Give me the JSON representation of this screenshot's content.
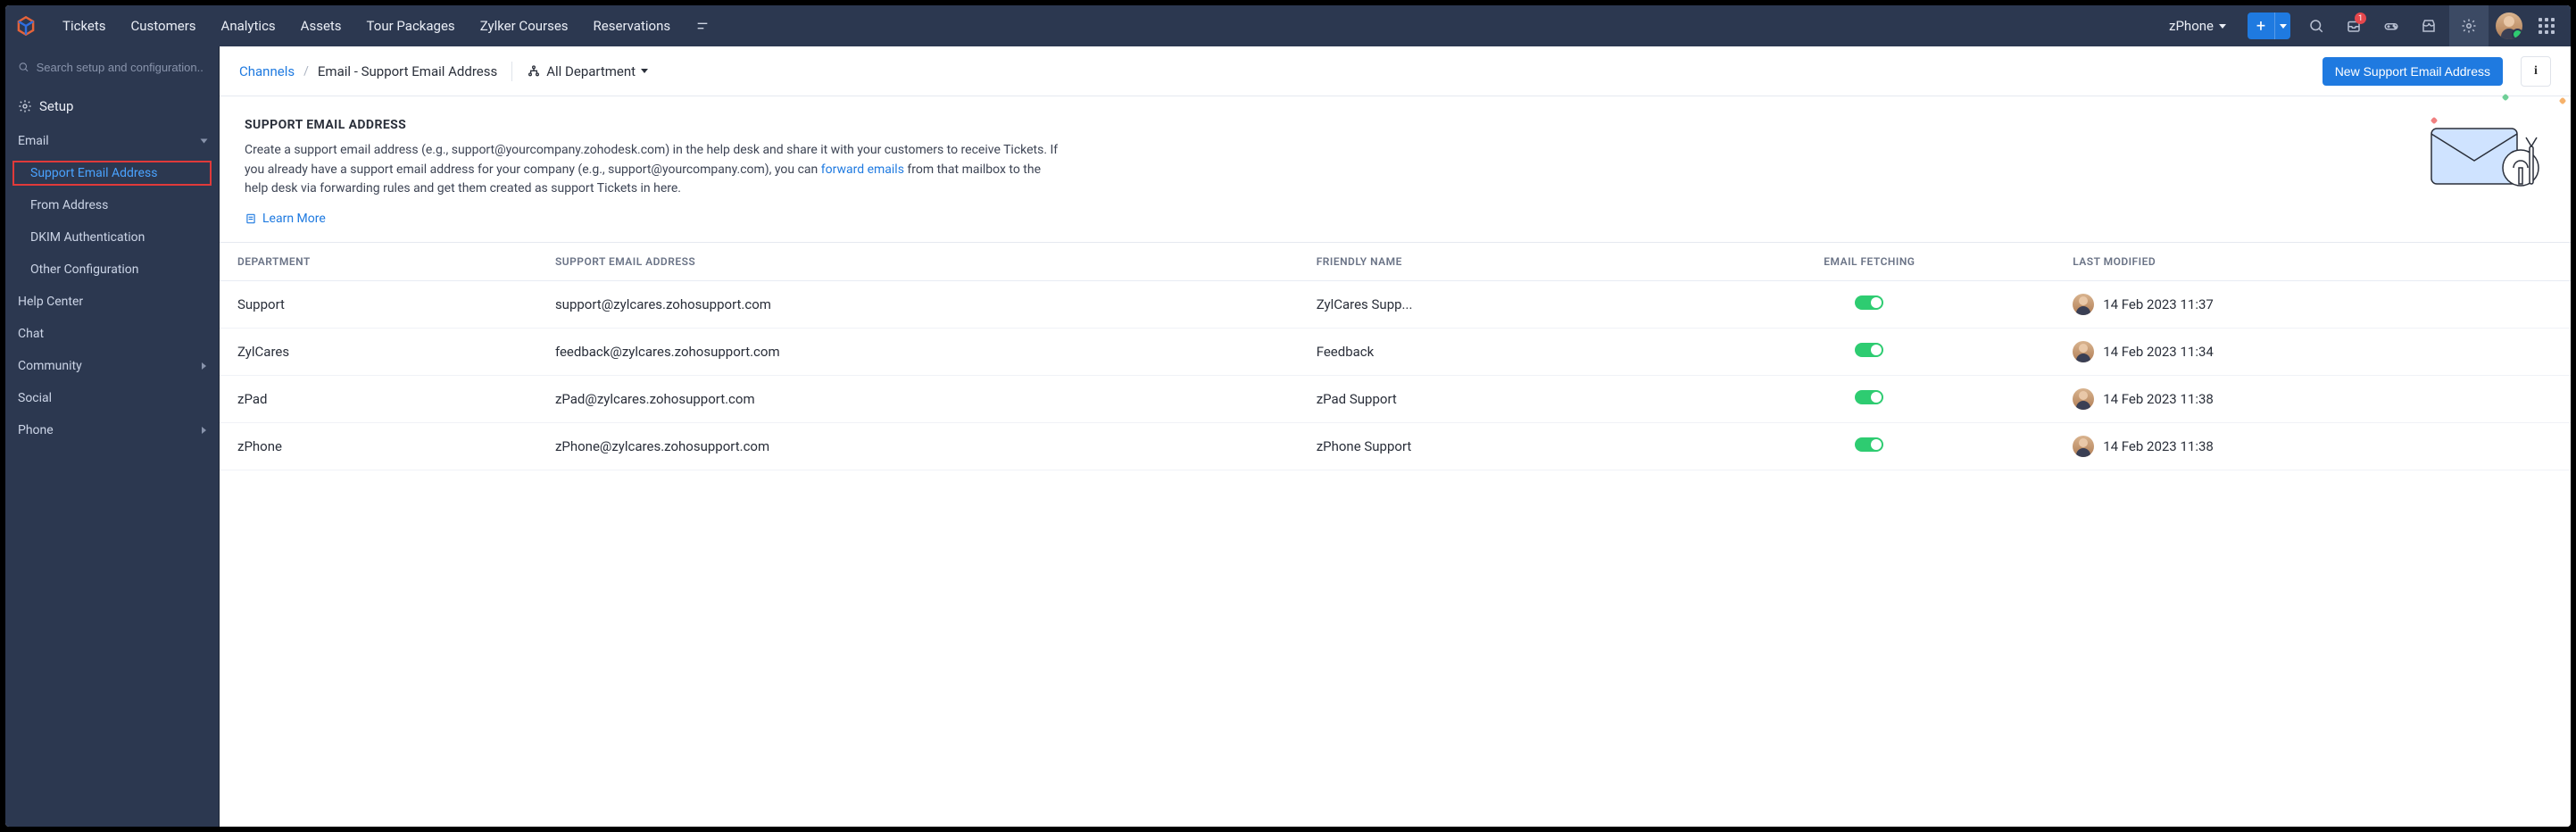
{
  "nav": {
    "items": [
      "Tickets",
      "Customers",
      "Analytics",
      "Assets",
      "Tour Packages",
      "Zylker Courses",
      "Reservations"
    ],
    "dept": "zPhone",
    "notif_badge": "1"
  },
  "sidebar": {
    "search_placeholder": "Search setup and configuration..",
    "section": "Setup",
    "items": [
      {
        "label": "Email",
        "expandable": true,
        "expanded": true
      },
      {
        "label": "Support Email Address",
        "sub": true,
        "active": true,
        "highlight": true
      },
      {
        "label": "From Address",
        "sub": true
      },
      {
        "label": "DKIM Authentication",
        "sub": true
      },
      {
        "label": "Other Configuration",
        "sub": true
      },
      {
        "label": "Help Center"
      },
      {
        "label": "Chat"
      },
      {
        "label": "Community",
        "expandable": true
      },
      {
        "label": "Social"
      },
      {
        "label": "Phone",
        "expandable": true
      }
    ]
  },
  "breadcrumb": {
    "root": "Channels",
    "current": "Email - Support Email Address",
    "filter": "All Department"
  },
  "actions": {
    "new_btn": "New Support Email Address",
    "info_btn": "i"
  },
  "intro": {
    "heading": "SUPPORT EMAIL ADDRESS",
    "text_a": "Create a support email address (e.g., support@yourcompany.zohodesk.com) in the help desk and share it with your customers to receive Tickets. If you already have a support email address for your company (e.g., support@yourcompany.com), you can ",
    "link": "forward emails",
    "text_b": " from that mailbox to the help desk via forwarding rules and get them created as support Tickets in here.",
    "learn": "Learn More"
  },
  "table": {
    "columns": [
      "DEPARTMENT",
      "SUPPORT EMAIL ADDRESS",
      "FRIENDLY NAME",
      "EMAIL FETCHING",
      "LAST MODIFIED"
    ],
    "rows": [
      {
        "dept": "Support",
        "email": "support@zylcares.zohosupport.com",
        "friendly": "ZylCares Supp...",
        "fetch": true,
        "modified": "14 Feb 2023 11:37"
      },
      {
        "dept": "ZylCares",
        "email": "feedback@zylcares.zohosupport.com",
        "friendly": "Feedback",
        "fetch": true,
        "modified": "14 Feb 2023 11:34"
      },
      {
        "dept": "zPad",
        "email": "zPad@zylcares.zohosupport.com",
        "friendly": "zPad Support",
        "fetch": true,
        "modified": "14 Feb 2023 11:38"
      },
      {
        "dept": "zPhone",
        "email": "zPhone@zylcares.zohosupport.com",
        "friendly": "zPhone Support",
        "fetch": true,
        "modified": "14 Feb 2023 11:38"
      }
    ]
  }
}
